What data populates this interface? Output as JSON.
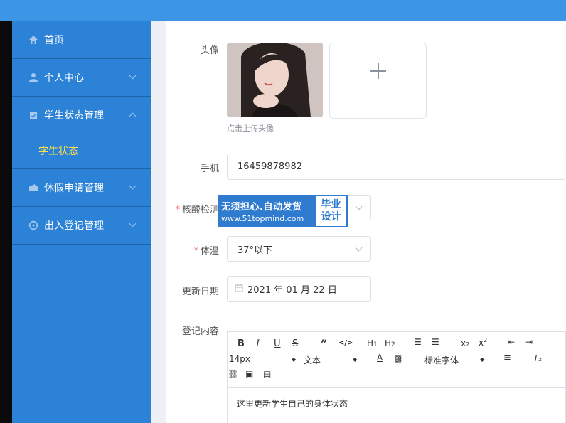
{
  "sidebar": {
    "items": [
      {
        "label": "首页",
        "icon": "home-icon"
      },
      {
        "label": "个人中心",
        "icon": "user-icon"
      },
      {
        "label": "学生状态管理",
        "icon": "clipboard-icon"
      },
      {
        "label": "学生状态"
      },
      {
        "label": "休假申请管理",
        "icon": "wallet-icon"
      },
      {
        "label": "出入登记管理",
        "icon": "compass-icon"
      }
    ]
  },
  "form": {
    "avatar_label": "头像",
    "upload_hint": "点击上传头像",
    "phone_label": "手机",
    "phone_value": "16459878982",
    "nucleic_label": "核酸检测",
    "temp_label": "体温",
    "temp_value": "37°以下",
    "date_label": "更新日期",
    "date_value": "2021 年 01 月 22 日",
    "content_label": "登记内容"
  },
  "watermark": {
    "line1": "无须担心.自动发货",
    "line2": "www.51topmind.com",
    "right1": "毕业",
    "right2": "设计"
  },
  "editor": {
    "font_size": "14px",
    "text_type": "文本",
    "font_family": "标准字体",
    "content": "这里更新学生自己的身体状态",
    "h1": "H1",
    "h2": "H2"
  },
  "colors": {
    "topbar": "#3d95e6",
    "sidebar": "#2b82d6",
    "active_submenu": "#ffe34d",
    "required": "#f56c6c"
  }
}
